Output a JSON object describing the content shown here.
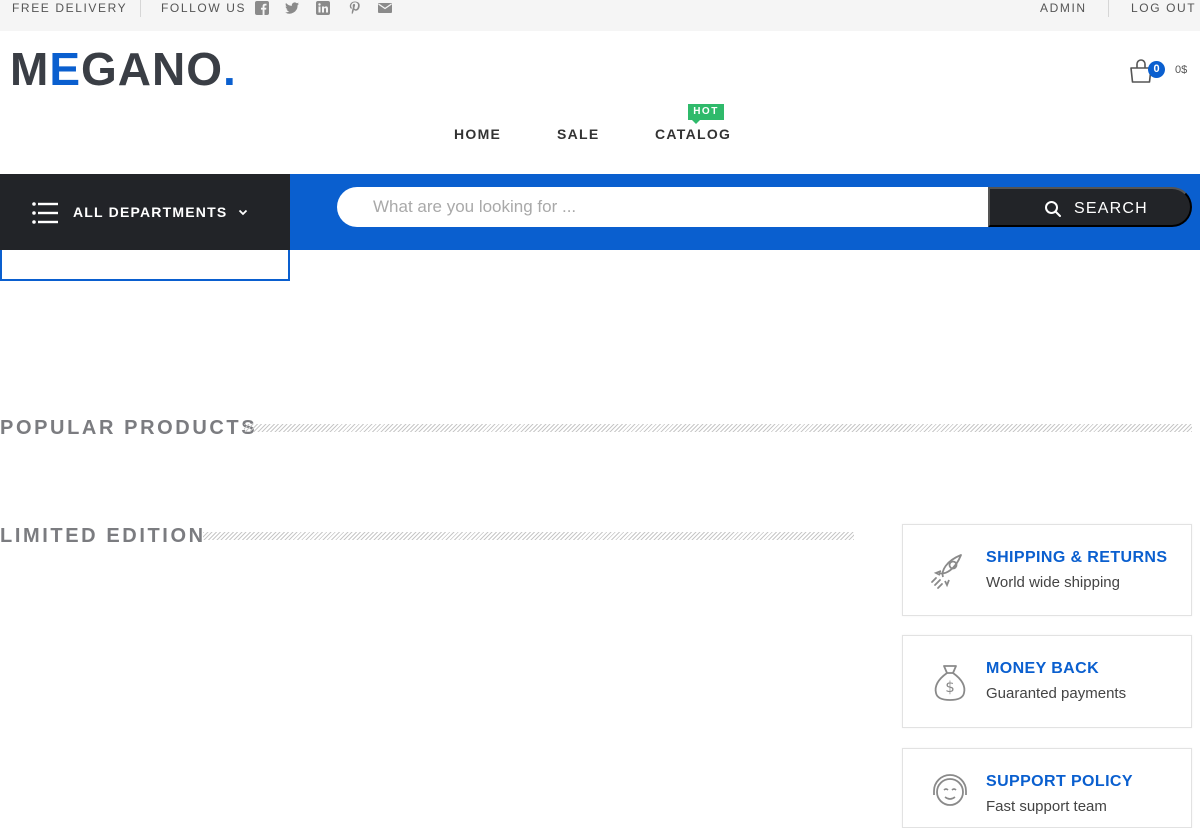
{
  "topbar": {
    "free_delivery": "FREE DELIVERY",
    "follow_us": "FOLLOW US",
    "social_icons": [
      "facebook-icon",
      "twitter-icon",
      "linkedin-icon",
      "pinterest-icon",
      "email-icon"
    ],
    "admin": "ADMIN",
    "logout": "LOG OUT"
  },
  "logo": {
    "m": "M",
    "e": "E",
    "rest": "GANO",
    "dot": "."
  },
  "cart": {
    "count": "0",
    "total": "0$"
  },
  "nav": {
    "items": [
      "HOME",
      "SALE",
      "CATALOG"
    ],
    "hot_badge": "HOT"
  },
  "departments": {
    "label": "ALL DEPARTMENTS"
  },
  "search": {
    "placeholder": "What are you looking for ...",
    "button": "SEARCH"
  },
  "sections": {
    "popular": "POPULAR PRODUCTS",
    "limited": "LIMITED EDITION"
  },
  "features": [
    {
      "icon": "rocket-icon",
      "title": "SHIPPING & RETURNS",
      "subtitle": "World wide shipping"
    },
    {
      "icon": "money-bag-icon",
      "title": "MONEY BACK",
      "subtitle": "Guaranted payments"
    },
    {
      "icon": "support-agent-icon",
      "title": "SUPPORT POLICY",
      "subtitle": "Fast support team"
    }
  ],
  "colors": {
    "accent": "#0a5fcf",
    "dark": "#222428",
    "hot": "#2fba6b",
    "muted": "#7b7c80"
  }
}
